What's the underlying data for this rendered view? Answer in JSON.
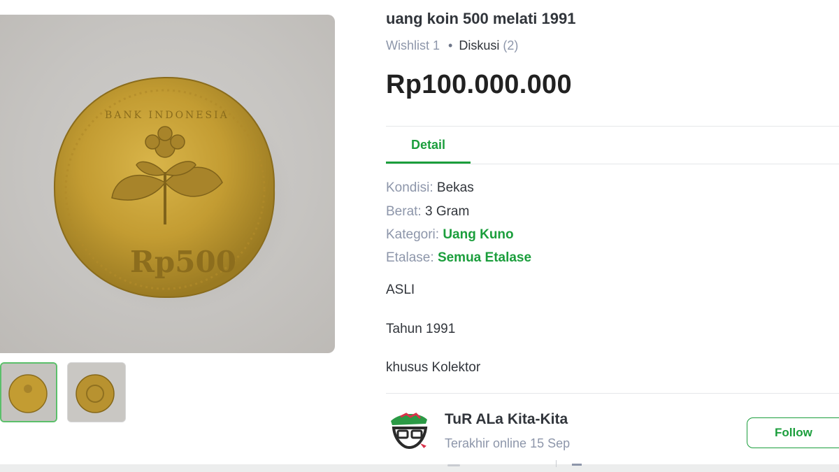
{
  "product": {
    "title": "uang koin 500 melati 1991",
    "wishlist": "Wishlist 1",
    "separator": "•",
    "diskusi_label": "Diskusi",
    "diskusi_count": "(2)",
    "price": "Rp100.000.000",
    "coin_text": "Rp500"
  },
  "tabs": [
    {
      "label": "Detail",
      "active": true
    }
  ],
  "details": {
    "kondisi_key": "Kondisi:",
    "kondisi_val": "Bekas",
    "berat_key": "Berat:",
    "berat_val": "3 Gram",
    "kategori_key": "Kategori:",
    "kategori_val": "Uang Kuno",
    "etalase_key": "Etalase:",
    "etalase_val": "Semua Etalase"
  },
  "description": [
    "ASLI",
    "Tahun 1991",
    "khusus Kolektor"
  ],
  "shop": {
    "name": "TuR ALa Kita-Kita",
    "status": "Terakhir online 15 Sep",
    "follow_label": "Follow"
  },
  "colors": {
    "accent_green": "#1b9e3c",
    "text_primary": "#31353b",
    "text_muted": "#8d96aa",
    "coin_gold": "#c9a43a"
  },
  "icons": {
    "shop_avatar": "shop-logo-icon"
  }
}
